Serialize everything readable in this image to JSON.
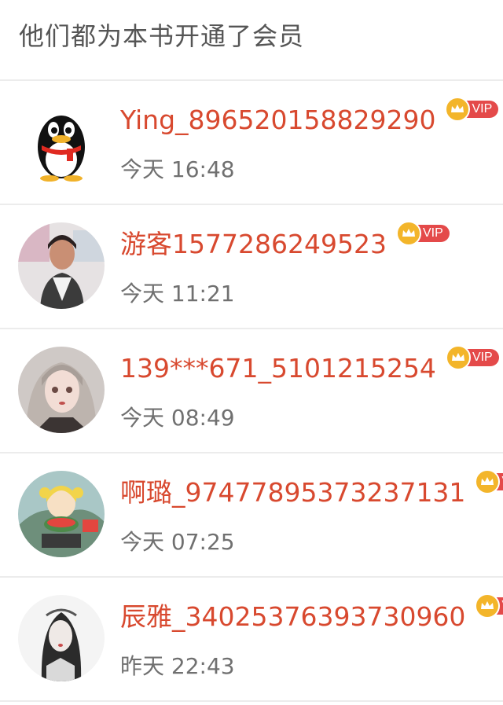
{
  "header": {
    "title": "他们都为本书开通了会员"
  },
  "members": [
    {
      "name": "Ying_896520158829290",
      "time": "今天 16:48",
      "vip": "VIP",
      "avatar": "qq-penguin-icon"
    },
    {
      "name": "游客1577286249523",
      "time": "今天 11:21",
      "vip": "VIP",
      "avatar": "woman-photo"
    },
    {
      "name": "139***671_5101215254",
      "time": "今天 08:49",
      "vip": "VIP",
      "avatar": "anime-girl"
    },
    {
      "name": "啊璐_974778953732371​31",
      "time": "今天 07:25",
      "vip": "VIP",
      "avatar": "cartoon-girl"
    },
    {
      "name": "辰雅_34025376393730960",
      "time": "昨天 22:43",
      "vip": "VIP",
      "avatar": "sketch-girl"
    }
  ],
  "colors": {
    "name": "#d8492f",
    "vip": "#e44a4a",
    "crown": "#f3b52a"
  }
}
